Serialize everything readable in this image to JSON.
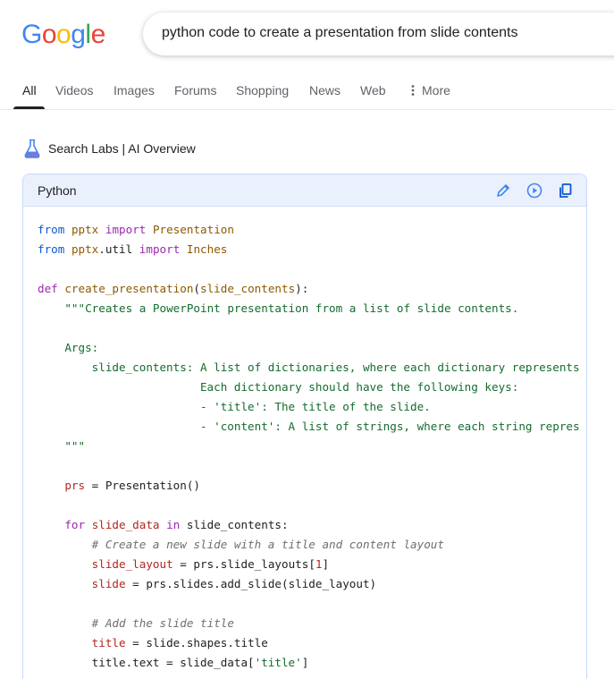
{
  "logo": {
    "letters": [
      "G",
      "o",
      "o",
      "g",
      "l",
      "e"
    ],
    "colors": [
      "#4285F4",
      "#EA4335",
      "#FBBC05",
      "#4285F4",
      "#34A853",
      "#EA4335"
    ]
  },
  "search": {
    "query": "python code to create a presentation from slide contents"
  },
  "tabs": [
    {
      "label": "All"
    },
    {
      "label": "Videos"
    },
    {
      "label": "Images"
    },
    {
      "label": "Forums"
    },
    {
      "label": "Shopping"
    },
    {
      "label": "News"
    },
    {
      "label": "Web"
    },
    {
      "label": "More"
    }
  ],
  "overview": {
    "label": "Search Labs | AI Overview"
  },
  "code_block": {
    "language": "Python",
    "icons": [
      "edit-icon",
      "play-icon",
      "copy-icon"
    ],
    "lines": [
      [
        [
          "kw2",
          "from"
        ],
        [
          "",
          " "
        ],
        [
          "cls",
          "pptx"
        ],
        [
          "",
          " "
        ],
        [
          "kw",
          "import"
        ],
        [
          "",
          " "
        ],
        [
          "cls",
          "Presentation"
        ]
      ],
      [
        [
          "kw2",
          "from"
        ],
        [
          "",
          " "
        ],
        [
          "cls",
          "pptx"
        ],
        [
          "",
          ".util "
        ],
        [
          "kw",
          "import"
        ],
        [
          "",
          " "
        ],
        [
          "cls",
          "Inches"
        ]
      ],
      [],
      [
        [
          "kw",
          "def"
        ],
        [
          "",
          " "
        ],
        [
          "cls",
          "create_presentation"
        ],
        [
          "",
          "("
        ],
        [
          "cls",
          "slide_contents"
        ],
        [
          "",
          "):"
        ]
      ],
      [
        [
          "",
          "    "
        ],
        [
          "str",
          "\"\"\"Creates a PowerPoint presentation from a list of slide contents."
        ]
      ],
      [],
      [
        [
          "str",
          "    Args:"
        ]
      ],
      [
        [
          "str",
          "        slide_contents: A list of dictionaries, where each dictionary represents"
        ]
      ],
      [
        [
          "str",
          "                        Each dictionary should have the following keys:"
        ]
      ],
      [
        [
          "str",
          "                        - 'title': The title of the slide."
        ]
      ],
      [
        [
          "str",
          "                        - 'content': A list of strings, where each string repres"
        ]
      ],
      [
        [
          "str",
          "    \"\"\""
        ]
      ],
      [],
      [
        [
          "",
          "    "
        ],
        [
          "va",
          "prs"
        ],
        [
          "",
          " = Presentation()"
        ]
      ],
      [],
      [
        [
          "",
          "    "
        ],
        [
          "kw",
          "for"
        ],
        [
          "",
          " "
        ],
        [
          "va",
          "slide_data"
        ],
        [
          "",
          " "
        ],
        [
          "kw",
          "in"
        ],
        [
          "",
          " slide_contents:"
        ]
      ],
      [
        [
          "",
          "        "
        ],
        [
          "cm",
          "# Create a new slide with a title and content layout"
        ]
      ],
      [
        [
          "",
          "        "
        ],
        [
          "va",
          "slide_layout"
        ],
        [
          "",
          " = prs.slide_layouts["
        ],
        [
          "num",
          "1"
        ],
        [
          "",
          "]"
        ]
      ],
      [
        [
          "",
          "        "
        ],
        [
          "va",
          "slide"
        ],
        [
          "",
          " = prs.slides.add_slide(slide_layout)"
        ]
      ],
      [],
      [
        [
          "",
          "        "
        ],
        [
          "cm",
          "# Add the slide title"
        ]
      ],
      [
        [
          "",
          "        "
        ],
        [
          "va",
          "title"
        ],
        [
          "",
          " = slide.shapes.title"
        ]
      ],
      [
        [
          "",
          "        title.text = slide_data["
        ],
        [
          "str",
          "'title'"
        ],
        [
          "",
          "]"
        ]
      ]
    ]
  }
}
